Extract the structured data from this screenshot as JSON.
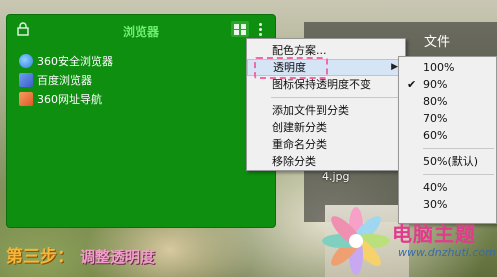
{
  "fence": {
    "title": "浏览器",
    "items": [
      {
        "label": "360安全浏览器",
        "icon": "360-browser-icon",
        "color": "#2e7de0"
      },
      {
        "label": "百度浏览器",
        "icon": "baidu-browser-icon",
        "color": "#3a5fc8"
      },
      {
        "label": "360网址导航",
        "icon": "360-nav-icon",
        "color": "#e0552b"
      }
    ]
  },
  "file_panel": {
    "title": "文件",
    "file_label": "4.jpg"
  },
  "context_menu": {
    "items": [
      {
        "label": "配色方案...",
        "type": "item"
      },
      {
        "label": "透明度",
        "type": "submenu",
        "highlighted": true
      },
      {
        "label": "图标保持透明度不变",
        "type": "item"
      },
      {
        "type": "separator"
      },
      {
        "label": "添加文件到分类",
        "type": "item"
      },
      {
        "label": "创建新分类",
        "type": "item"
      },
      {
        "label": "重命名分类",
        "type": "item"
      },
      {
        "label": "移除分类",
        "type": "item"
      }
    ]
  },
  "transparency_menu": {
    "selected": "90%",
    "items": [
      "100%",
      "90%",
      "80%",
      "70%",
      "60%",
      "50%(默认)",
      "40%",
      "30%"
    ]
  },
  "caption": {
    "step": "第三步：",
    "text": "调整透明度"
  },
  "watermark": {
    "brand": "电脑主题",
    "url": "www.dnzhuti.com"
  },
  "colors": {
    "fence_green": "#0e8f10",
    "highlight_dash": "#f06aa8",
    "caption": "#f5b73a",
    "watermark": "#e23a8c"
  }
}
